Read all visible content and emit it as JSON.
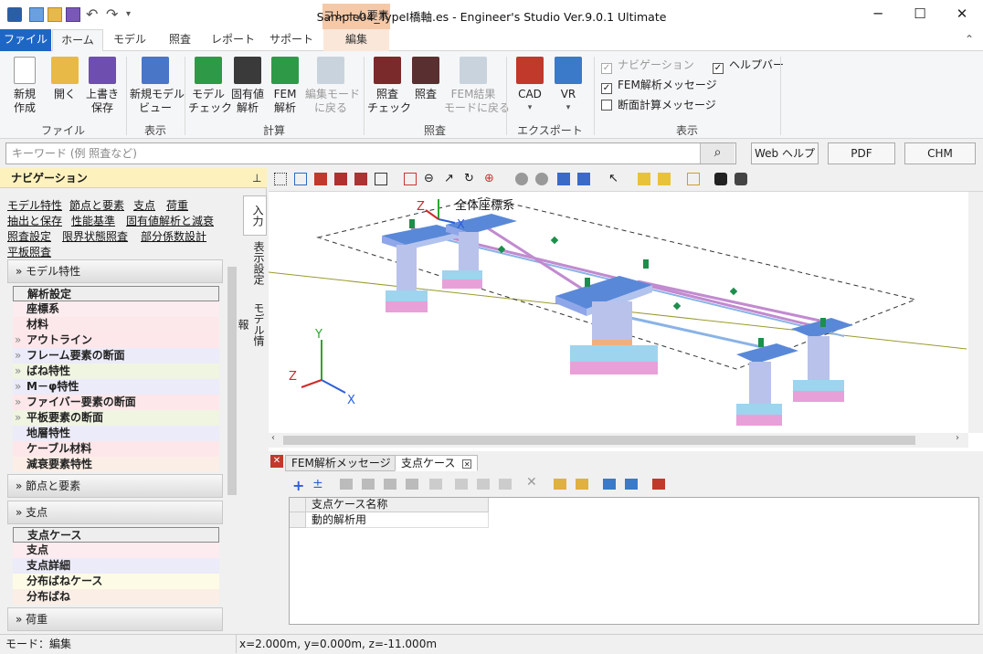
{
  "titlebar": {
    "title": "Sample04_TypeI橋軸.es - Engineer's Studio Ver.9.0.1 Ultimate",
    "context_tab": "フレーム要素",
    "minimize": "─",
    "maximize": "☐",
    "close": "✕"
  },
  "ribbon_tabs": [
    "ファイル",
    "ホーム",
    "モデル",
    "照査",
    "レポート",
    "サポート",
    "編集"
  ],
  "ribbon": {
    "groups": {
      "file": "ファイル",
      "display": "表示",
      "calc": "計算",
      "check": "照査",
      "export": "エクスポート",
      "display2": "表示"
    },
    "buttons": {
      "new": "新規\n作成",
      "open": "開く",
      "save": "上書き\n保存",
      "new_view": "新規モデル\nビュー",
      "model_check": "モデル\nチェック",
      "eigen": "固有値\n解析",
      "fem": "FEM\n解析",
      "back_edit": "編集モード\nに戻る",
      "check_check": "照査\nチェック",
      "check": "照査",
      "fem_result": "FEM結果\nモードに戻る",
      "cad": "CAD",
      "vr": "VR"
    },
    "checkboxes": {
      "navigation": "ナビゲーション",
      "helpbar": "ヘルプバー",
      "fem_msg": "FEM解析メッセージ",
      "section_msg": "断面計算メッセージ"
    }
  },
  "search": {
    "placeholder": "キーワード (例 照査など)",
    "web_help": "Web ヘルプ",
    "pdf": "PDF",
    "chm": "CHM"
  },
  "nav": {
    "title": "ナビゲーション",
    "links": [
      "モデル特性",
      "節点と要素",
      "支点",
      "荷重",
      "抽出と保存",
      "性能基準",
      "固有値解析と減衰",
      "照査設定",
      "限界状態照査",
      "部分係数設計",
      "平板照査"
    ],
    "sections": {
      "model": "モデル特性",
      "nodes": "節点と要素",
      "support": "支点",
      "load": "荷重"
    },
    "model_items": [
      "解析設定",
      "座標系",
      "材料",
      "アウトライン",
      "フレーム要素の断面",
      "ばね特性",
      "M－φ特性",
      "ファイバー要素の断面",
      "平板要素の断面",
      "地層特性",
      "ケーブル材料",
      "減衰要素特性"
    ],
    "support_items": [
      "支点ケース",
      "支点",
      "支点詳細",
      "分布ばねケース",
      "分布ばね"
    ],
    "vtabs": [
      "入力",
      "表示設定",
      "モデル情報"
    ]
  },
  "view": {
    "label": "全体座標系",
    "axes": {
      "x": "X",
      "y": "Y",
      "z": "Z"
    }
  },
  "bottom": {
    "tabs": [
      "FEM解析メッセージ",
      "支点ケース"
    ],
    "grid_header": "支点ケース名称",
    "rows": [
      "動的解析用"
    ]
  },
  "status": {
    "mode": "モード：編集",
    "coords": "x=2.000m, y=0.000m, z=-11.000m"
  },
  "colors": {
    "accent": "#1e66c6",
    "nav_header": "#fdf1bd",
    "context": "#f5c9a8"
  }
}
